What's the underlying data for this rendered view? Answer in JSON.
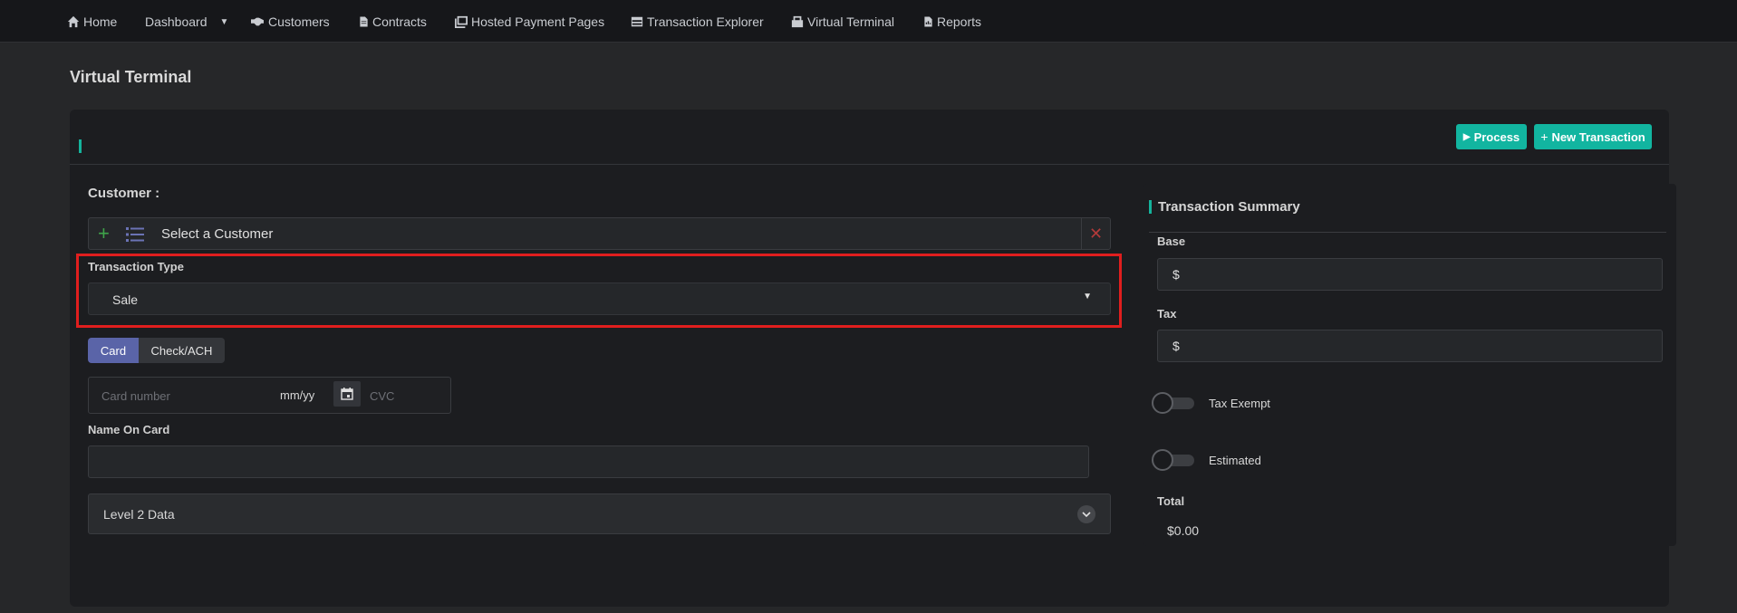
{
  "nav": {
    "home": "Home",
    "dashboard": "Dashboard",
    "customers": "Customers",
    "contracts": "Contracts",
    "hosted_payment_pages": "Hosted Payment Pages",
    "transaction_explorer": "Transaction Explorer",
    "virtual_terminal": "Virtual Terminal",
    "reports": "Reports"
  },
  "page": {
    "title": "Virtual Terminal"
  },
  "toolbar": {
    "process_label": "Process",
    "new_transaction_label": "New Transaction"
  },
  "form": {
    "customer_label": "Customer :",
    "customer_placeholder": "Select a Customer",
    "transaction_type_label": "Transaction Type",
    "transaction_type_value": "Sale",
    "tabs": [
      "Card",
      "Check/ACH"
    ],
    "active_tab": "Card",
    "card_number_placeholder": "Card number",
    "expiry_placeholder": "mm/yy",
    "cvc_placeholder": "CVC",
    "name_on_card_label": "Name On Card",
    "name_on_card_value": "",
    "level2_label": "Level 2 Data"
  },
  "summary": {
    "title": "Transaction Summary",
    "base_label": "Base",
    "base_prefix": "$",
    "tax_label": "Tax",
    "tax_prefix": "$",
    "tax_exempt_label": "Tax Exempt",
    "estimated_label": "Estimated",
    "total_label": "Total",
    "total_value": "$0.00"
  },
  "colors": {
    "accent": "#12b5a0",
    "tab_active": "#5a64a8",
    "highlight": "#e01e1e"
  }
}
